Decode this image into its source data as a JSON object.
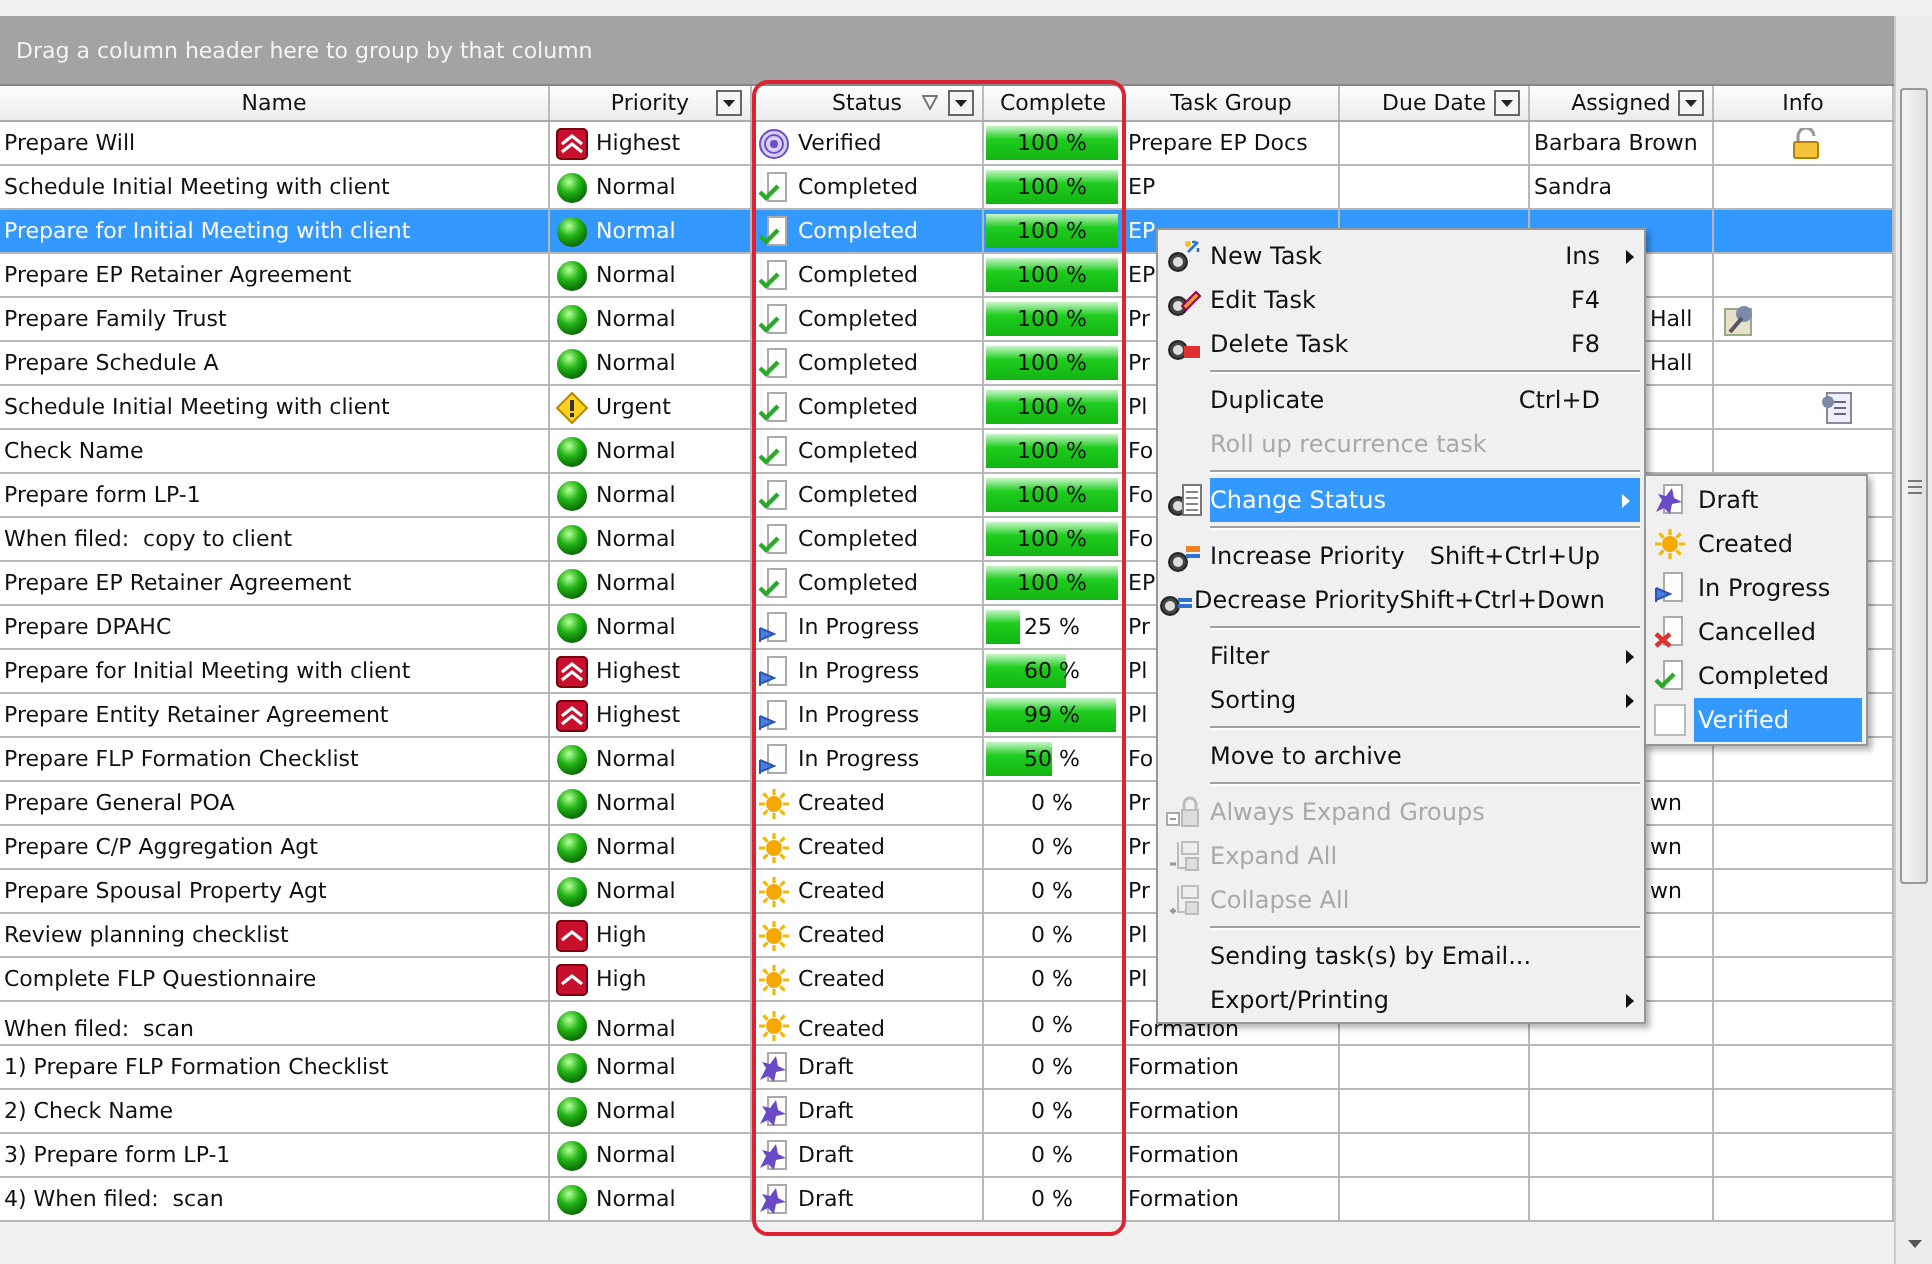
{
  "group_panel": {
    "hint": "Drag a column header here to group by that column"
  },
  "columns": [
    {
      "label": "Name",
      "filter": false,
      "sorted": false
    },
    {
      "label": "Priority",
      "filter": true,
      "sorted": false
    },
    {
      "label": "Status",
      "filter": true,
      "sorted": true
    },
    {
      "label": "Complete",
      "filter": false,
      "sorted": false
    },
    {
      "label": "Task Group",
      "filter": false,
      "sorted": false
    },
    {
      "label": "Due Date",
      "filter": true,
      "sorted": false
    },
    {
      "label": "Assigned",
      "filter": true,
      "sorted": false
    },
    {
      "label": "Info",
      "filter": false,
      "sorted": false
    }
  ],
  "rows": [
    {
      "name": "Prepare Will",
      "priority": {
        "kind": "highest",
        "label": "Highest"
      },
      "status": {
        "kind": "verified",
        "label": "Verified"
      },
      "complete": {
        "level": 1,
        "reading": "100 %"
      },
      "task_group": "Prepare EP Docs",
      "assigned": "Barbara Brown",
      "info": {
        "kind": "lock"
      },
      "selected": false
    },
    {
      "name": "Schedule Initial Meeting with client",
      "priority": {
        "kind": "normal",
        "label": "Normal"
      },
      "status": {
        "kind": "completed",
        "label": "Completed"
      },
      "complete": {
        "level": 1,
        "reading": "100 %"
      },
      "task_group": "EP",
      "assigned": "Sandra",
      "selected": false
    },
    {
      "name": "Prepare for Initial Meeting with client",
      "priority": {
        "kind": "normal",
        "label": "Normal"
      },
      "status": {
        "kind": "completed",
        "label": "Completed"
      },
      "complete": {
        "level": 1,
        "reading": "100 %"
      },
      "task_group": "EP",
      "selected": true
    },
    {
      "name": "Prepare EP Retainer Agreement",
      "priority": {
        "kind": "normal",
        "label": "Normal"
      },
      "status": {
        "kind": "completed",
        "label": "Completed"
      },
      "complete": {
        "level": 1,
        "reading": "100 %"
      },
      "task_group": "EP",
      "selected": false
    },
    {
      "name": "Prepare Family Trust",
      "priority": {
        "kind": "normal",
        "label": "Normal"
      },
      "status": {
        "kind": "completed",
        "label": "Completed"
      },
      "complete": {
        "level": 1,
        "reading": "100 %"
      },
      "task_group": "Pr",
      "assigned": "Hall",
      "info": {
        "kind": "tool"
      },
      "selected": false
    },
    {
      "name": "Prepare Schedule A",
      "priority": {
        "kind": "normal",
        "label": "Normal"
      },
      "status": {
        "kind": "completed",
        "label": "Completed"
      },
      "complete": {
        "level": 1,
        "reading": "100 %"
      },
      "task_group": "Pr",
      "assigned": "Hall",
      "selected": false
    },
    {
      "name": "Schedule Initial Meeting with client",
      "priority": {
        "kind": "urgent",
        "label": "Urgent"
      },
      "status": {
        "kind": "completed",
        "label": "Completed"
      },
      "complete": {
        "level": 1,
        "reading": "100 %"
      },
      "task_group": "Pl",
      "info": {
        "kind": "note"
      },
      "selected": false
    },
    {
      "name": "Check Name",
      "priority": {
        "kind": "normal",
        "label": "Normal"
      },
      "status": {
        "kind": "completed",
        "label": "Completed"
      },
      "complete": {
        "level": 1,
        "reading": "100 %"
      },
      "task_group": "Fo",
      "selected": false
    },
    {
      "name": "Prepare form LP-1",
      "priority": {
        "kind": "normal",
        "label": "Normal"
      },
      "status": {
        "kind": "completed",
        "label": "Completed"
      },
      "complete": {
        "level": 1,
        "reading": "100 %"
      },
      "task_group": "Fo",
      "selected": false
    },
    {
      "name": "When filed:  copy to client",
      "priority": {
        "kind": "normal",
        "label": "Normal"
      },
      "status": {
        "kind": "completed",
        "label": "Completed"
      },
      "complete": {
        "level": 1,
        "reading": "100 %"
      },
      "task_group": "Fo",
      "selected": false
    },
    {
      "name": "Prepare EP Retainer Agreement",
      "priority": {
        "kind": "normal",
        "label": "Normal"
      },
      "status": {
        "kind": "completed",
        "label": "Completed"
      },
      "complete": {
        "level": 1,
        "reading": "100 %"
      },
      "task_group": "EP",
      "selected": false
    },
    {
      "name": "Prepare DPAHC",
      "priority": {
        "kind": "normal",
        "label": "Normal"
      },
      "status": {
        "kind": "in_progress",
        "label": "In Progress"
      },
      "complete": {
        "level": 0.25,
        "reading": "25 %"
      },
      "task_group": "Pr",
      "selected": false
    },
    {
      "name": "Prepare for Initial Meeting with client",
      "priority": {
        "kind": "highest",
        "label": "Highest"
      },
      "status": {
        "kind": "in_progress",
        "label": "In Progress"
      },
      "complete": {
        "level": 0.6,
        "reading": "60 %"
      },
      "task_group": "Pl",
      "selected": false
    },
    {
      "name": "Prepare Entity Retainer Agreement",
      "priority": {
        "kind": "highest",
        "label": "Highest"
      },
      "status": {
        "kind": "in_progress",
        "label": "In Progress"
      },
      "complete": {
        "level": 0.99,
        "reading": "99 %"
      },
      "task_group": "Pl",
      "selected": false
    },
    {
      "name": "Prepare FLP Formation Checklist",
      "priority": {
        "kind": "normal",
        "label": "Normal"
      },
      "status": {
        "kind": "in_progress",
        "label": "In Progress"
      },
      "complete": {
        "level": 0.5,
        "reading": "50 %"
      },
      "task_group": "Fo",
      "selected": false
    },
    {
      "name": "Prepare General POA",
      "priority": {
        "kind": "normal",
        "label": "Normal"
      },
      "status": {
        "kind": "created",
        "label": "Created"
      },
      "complete": {
        "reading": "0 %"
      },
      "task_group": "Pr",
      "assigned": "wn",
      "selected": false
    },
    {
      "name": "Prepare C/P Aggregation Agt",
      "priority": {
        "kind": "normal",
        "label": "Normal"
      },
      "status": {
        "kind": "created",
        "label": "Created"
      },
      "complete": {
        "reading": "0 %"
      },
      "task_group": "Pr",
      "assigned": "wn",
      "selected": false
    },
    {
      "name": "Prepare Spousal Property Agt",
      "priority": {
        "kind": "normal",
        "label": "Normal"
      },
      "status": {
        "kind": "created",
        "label": "Created"
      },
      "complete": {
        "reading": "0 %"
      },
      "task_group": "Pr",
      "assigned": "wn",
      "selected": false
    },
    {
      "name": "Review planning checklist",
      "priority": {
        "kind": "high",
        "label": "High"
      },
      "status": {
        "kind": "created",
        "label": "Created"
      },
      "complete": {
        "reading": "0 %"
      },
      "task_group": "Pl",
      "selected": false
    },
    {
      "name": "Complete FLP Questionnaire",
      "priority": {
        "kind": "high",
        "label": "High"
      },
      "status": {
        "kind": "created",
        "label": "Created"
      },
      "complete": {
        "reading": "0 %"
      },
      "task_group": "Pl",
      "selected": false
    },
    {
      "name": "When filed:  scan",
      "priority": {
        "kind": "normal",
        "label": "Normal"
      },
      "status": {
        "kind": "created",
        "label": "Created"
      },
      "complete": {
        "reading": "0 %"
      },
      "task_group": "Formation",
      "selected": false
    },
    {
      "name": "1) Prepare FLP Formation Checklist",
      "priority": {
        "kind": "normal",
        "label": "Normal"
      },
      "status": {
        "kind": "draft",
        "label": "Draft"
      },
      "complete": {
        "reading": "0 %"
      },
      "task_group": "Formation",
      "selected": false
    },
    {
      "name": "2) Check Name",
      "priority": {
        "kind": "normal",
        "label": "Normal"
      },
      "status": {
        "kind": "draft",
        "label": "Draft"
      },
      "complete": {
        "reading": "0 %"
      },
      "task_group": "Formation",
      "selected": false
    },
    {
      "name": "3) Prepare form LP-1",
      "priority": {
        "kind": "normal",
        "label": "Normal"
      },
      "status": {
        "kind": "draft",
        "label": "Draft"
      },
      "complete": {
        "reading": "0 %"
      },
      "task_group": "Formation",
      "selected": false
    },
    {
      "name": "4) When filed:  scan",
      "priority": {
        "kind": "normal",
        "label": "Normal"
      },
      "status": {
        "kind": "draft",
        "label": "Draft"
      },
      "complete": {
        "reading": "0 %"
      },
      "task_group": "Formation",
      "selected": false
    }
  ],
  "context_menu": {
    "groups": [
      [
        {
          "label": "New Task",
          "shortcut": "Ins",
          "submenu": true,
          "disabled": false,
          "selected": false
        },
        {
          "label": "Edit Task",
          "shortcut": "F4",
          "submenu": false,
          "disabled": false,
          "selected": false
        },
        {
          "label": "Delete Task",
          "shortcut": "F8",
          "submenu": false,
          "disabled": false,
          "selected": false
        }
      ],
      [
        {
          "label": "Duplicate",
          "shortcut": "Ctrl+D",
          "submenu": false,
          "disabled": false,
          "selected": false
        },
        {
          "label": "Roll up recurrence task",
          "submenu": false,
          "disabled": true,
          "selected": false
        }
      ],
      [
        {
          "label": "Change Status",
          "submenu": true,
          "disabled": false,
          "selected": true
        }
      ],
      [
        {
          "label": "Increase Priority",
          "shortcut": "Shift+Ctrl+Up",
          "submenu": false,
          "disabled": false,
          "selected": false
        },
        {
          "label": "Decrease Priority",
          "shortcut": "Shift+Ctrl+Down",
          "submenu": false,
          "disabled": false,
          "selected": false
        }
      ],
      [
        {
          "label": "Filter",
          "submenu": true,
          "disabled": false,
          "selected": false
        },
        {
          "label": "Sorting",
          "submenu": true,
          "disabled": false,
          "selected": false
        }
      ],
      [
        {
          "label": "Move to archive",
          "submenu": false,
          "disabled": false,
          "selected": false
        }
      ],
      [
        {
          "label": "Always Expand Groups",
          "submenu": false,
          "disabled": true,
          "selected": false
        },
        {
          "label": "Expand All",
          "submenu": false,
          "disabled": true,
          "selected": false
        },
        {
          "label": "Collapse All",
          "submenu": false,
          "disabled": true,
          "selected": false
        }
      ],
      [
        {
          "label": "Sending task(s) by Email...",
          "submenu": false,
          "disabled": false,
          "selected": false
        },
        {
          "label": "Export/Printing",
          "submenu": true,
          "disabled": false,
          "selected": false
        }
      ]
    ]
  },
  "status_menu": {
    "items": [
      {
        "kind": "draft",
        "label": "Draft",
        "selected": false
      },
      {
        "kind": "created",
        "label": "Created",
        "selected": false
      },
      {
        "kind": "in_progress",
        "label": "In Progress",
        "selected": false
      },
      {
        "kind": "cancelled",
        "label": "Cancelled",
        "selected": false
      },
      {
        "kind": "completed",
        "label": "Completed",
        "selected": false
      },
      {
        "kind": "blank",
        "label": "Verified",
        "selected": true
      }
    ]
  }
}
